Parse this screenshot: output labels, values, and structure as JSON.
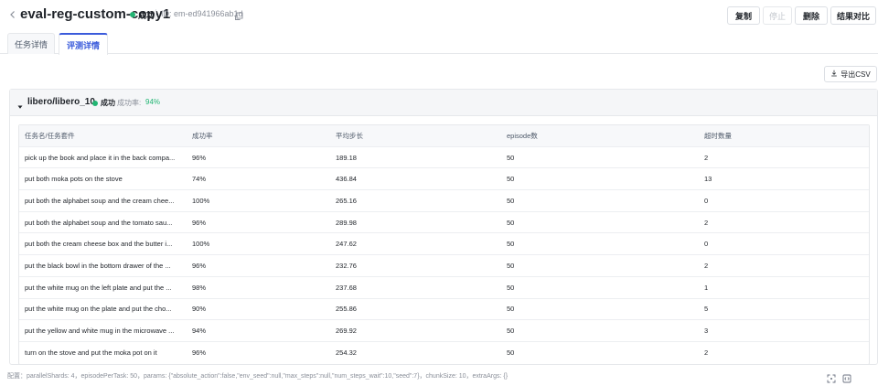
{
  "header": {
    "title": "eval-reg-custom-copy1",
    "status": "成功",
    "id_label": "ID: em-ed941966ab1d",
    "buttons": {
      "copy": "复制",
      "stop": "停止",
      "delete": "删除",
      "compare": "结果对比"
    }
  },
  "tabs": [
    {
      "label": "任务详情",
      "active": false
    },
    {
      "label": "评测详情",
      "active": true
    }
  ],
  "export_label": "导出CSV",
  "group": {
    "title": "libero/libero_10",
    "status": "成功",
    "rate_label": "成功率:",
    "rate_value": "94%"
  },
  "table": {
    "columns": [
      "任务名/任务套件",
      "成功率",
      "平均步长",
      "episode数",
      "超时数量"
    ],
    "rows": [
      [
        "pick up the book and place it in the back compa...",
        "96%",
        "189.18",
        "50",
        "2"
      ],
      [
        "put both moka pots on the stove",
        "74%",
        "436.84",
        "50",
        "13"
      ],
      [
        "put both the alphabet soup and the cream chee...",
        "100%",
        "265.16",
        "50",
        "0"
      ],
      [
        "put both the alphabet soup and the tomato sau...",
        "96%",
        "289.98",
        "50",
        "2"
      ],
      [
        "put both the cream cheese box and the butter i...",
        "100%",
        "247.62",
        "50",
        "0"
      ],
      [
        "put the black bowl in the bottom drawer of the ...",
        "96%",
        "232.76",
        "50",
        "2"
      ],
      [
        "put the white mug on the left plate and put the ...",
        "98%",
        "237.68",
        "50",
        "1"
      ],
      [
        "put the white mug on the plate and put the cho...",
        "90%",
        "255.86",
        "50",
        "5"
      ],
      [
        "put the yellow and white mug in the microwave ...",
        "94%",
        "269.92",
        "50",
        "3"
      ],
      [
        "turn on the stove and put the moka pot on it",
        "96%",
        "254.32",
        "50",
        "2"
      ]
    ]
  },
  "config_text": "配置：parallelShards: 4，episodePerTask: 50，params: {\"absolute_action\":false,\"env_seed\":null,\"max_steps\":null,\"num_steps_wait\":10,\"seed\":7}，chunkSize: 10，extraArgs: {}",
  "colors": {
    "accent": "#3b5bdb",
    "success": "#22b573",
    "muted": "#8a8f99"
  }
}
